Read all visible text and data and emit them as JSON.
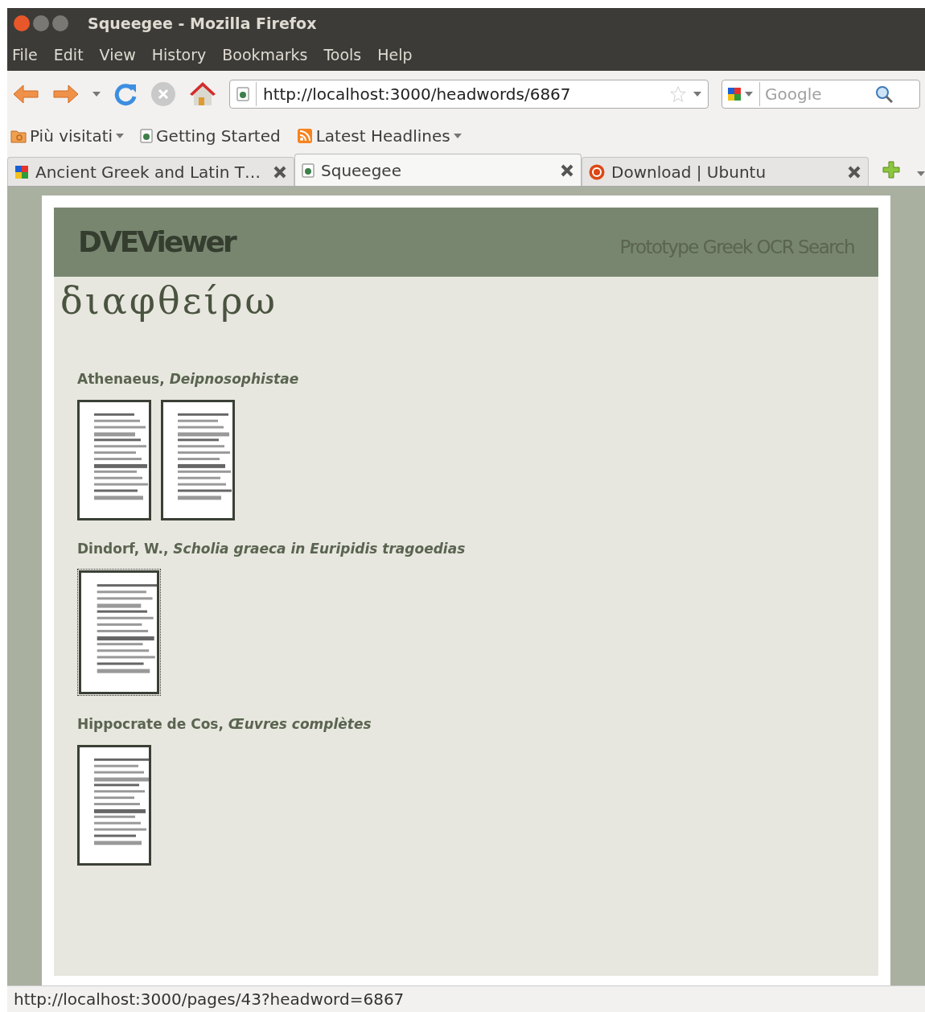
{
  "window": {
    "title": "Squeegee - Mozilla Firefox"
  },
  "menu": [
    "File",
    "Edit",
    "View",
    "History",
    "Bookmarks",
    "Tools",
    "Help"
  ],
  "address": {
    "value": "http://localhost:3000/headwords/6867"
  },
  "search": {
    "placeholder": "Google"
  },
  "bookmarks": [
    {
      "label": "Più visitati",
      "kind": "folder",
      "menu": true
    },
    {
      "label": "Getting Started",
      "kind": "page",
      "menu": false
    },
    {
      "label": "Latest Headlines",
      "kind": "feed",
      "menu": true
    }
  ],
  "tabs": [
    {
      "label": "Ancient Greek and Latin T…",
      "kind": "google",
      "selected": false
    },
    {
      "label": "Squeegee",
      "kind": "page",
      "selected": true
    },
    {
      "label": "Download | Ubuntu",
      "kind": "ubuntu",
      "selected": false
    }
  ],
  "page": {
    "logo": "DVEViewer",
    "tagline": "Prototype Greek OCR Search",
    "headword": "διαφθείρω",
    "works": [
      {
        "citation": "Athenaeus, *Deipnosophistae*",
        "pages": [
          {
            "kind": "picture",
            "focused": false
          },
          {
            "kind": "picture",
            "focused": false
          }
        ]
      },
      {
        "citation": "Dindorf, W., *Scholia graeca in Euripidis tragoedias*",
        "pages": [
          {
            "kind": "picture",
            "focused": true
          }
        ]
      },
      {
        "citation": "Hippocrate de Cos, *Œuvres complètes*",
        "pages": [
          {
            "kind": "picture",
            "focused": false
          }
        ]
      }
    ]
  },
  "status_bar": "http://localhost:3000/pages/43?headword=6867"
}
